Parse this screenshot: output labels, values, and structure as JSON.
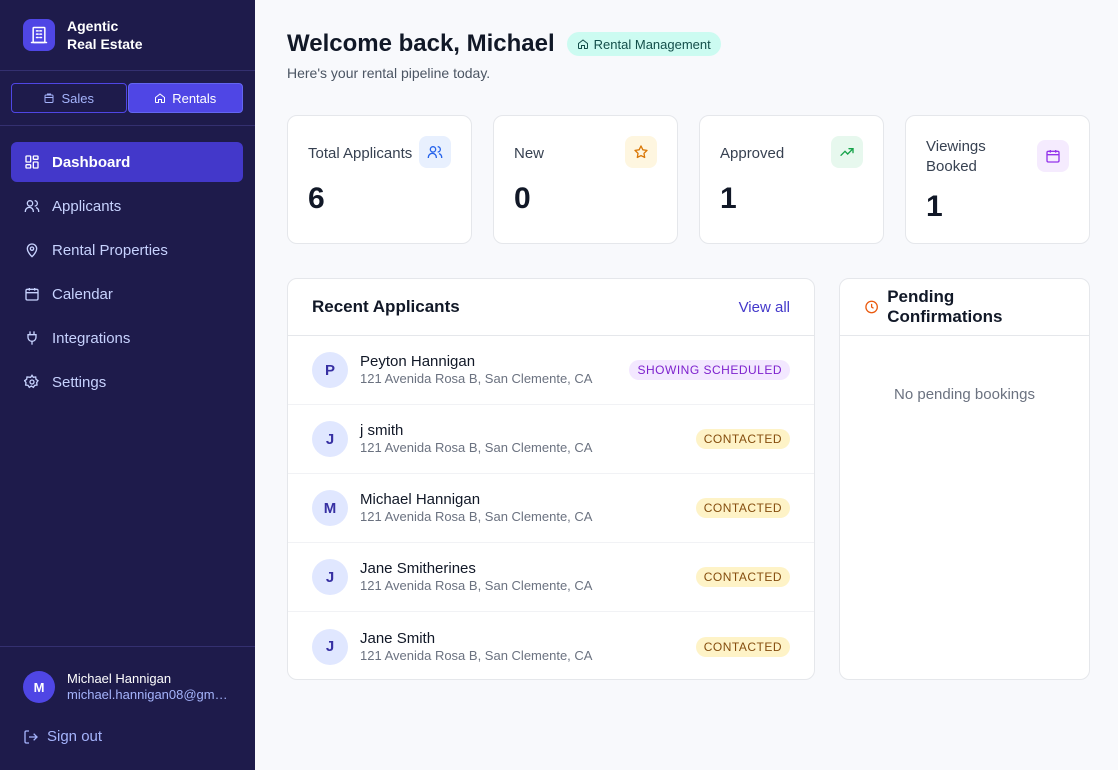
{
  "brand": {
    "line1": "Agentic",
    "line2": "Real Estate",
    "logo_icon": "building-icon",
    "color": "#4f46e5"
  },
  "mode_switch": {
    "sales": "Sales",
    "rentals": "Rentals",
    "active": "rentals"
  },
  "nav": [
    {
      "label": "Dashboard",
      "icon": "grid-icon",
      "active": true
    },
    {
      "label": "Applicants",
      "icon": "users-icon"
    },
    {
      "label": "Rental Properties",
      "icon": "map-pin-icon"
    },
    {
      "label": "Calendar",
      "icon": "calendar-icon"
    },
    {
      "label": "Integrations",
      "icon": "plug-icon"
    },
    {
      "label": "Settings",
      "icon": "gear-icon"
    }
  ],
  "user": {
    "initial": "M",
    "name": "Michael Hannigan",
    "email": "michael.hannigan08@gmail.com"
  },
  "signout": "Sign out",
  "header": {
    "title": "Welcome back, Michael",
    "pill": "Rental Management",
    "subtitle": "Here's your rental pipeline today."
  },
  "stats": [
    {
      "label": "Total Applicants",
      "value": "6",
      "icon": "users-icon",
      "icon_color": "#2563eb",
      "icon_bg": "#e8f0fe"
    },
    {
      "label": "New",
      "value": "0",
      "icon": "star-icon",
      "icon_color": "#d97706",
      "icon_bg": "#fef6e0"
    },
    {
      "label": "Approved",
      "value": "1",
      "icon": "trending-up-icon",
      "icon_color": "#16a34a",
      "icon_bg": "#e7f8ee"
    },
    {
      "label": "Viewings Booked",
      "value": "1",
      "icon": "calendar-icon",
      "icon_color": "#9333ea",
      "icon_bg": "#f5ebfe"
    }
  ],
  "recent": {
    "title": "Recent Applicants",
    "view_all": "View all",
    "rows": [
      {
        "initial": "P",
        "name": "Peyton Hannigan",
        "address": "121 Avenida Rosa B, San Clemente, CA",
        "status": "SHOWING SCHEDULED",
        "status_color": "#7e22ce",
        "status_bg": "#f3e8ff"
      },
      {
        "initial": "J",
        "name": "j smith",
        "address": "121 Avenida Rosa B, San Clemente, CA",
        "status": "CONTACTED",
        "status_color": "#854d0e",
        "status_bg": "#fef3c7"
      },
      {
        "initial": "M",
        "name": "Michael Hannigan",
        "address": "121 Avenida Rosa B, San Clemente, CA",
        "status": "CONTACTED",
        "status_color": "#854d0e",
        "status_bg": "#fef3c7"
      },
      {
        "initial": "J",
        "name": "Jane Smitherines",
        "address": "121 Avenida Rosa B, San Clemente, CA",
        "status": "CONTACTED",
        "status_color": "#854d0e",
        "status_bg": "#fef3c7"
      },
      {
        "initial": "J",
        "name": "Jane Smith",
        "address": "121 Avenida Rosa B, San Clemente, CA",
        "status": "CONTACTED",
        "status_color": "#854d0e",
        "status_bg": "#fef3c7"
      }
    ]
  },
  "pending": {
    "title": "Pending Confirmations",
    "icon": "clock-icon",
    "icon_color": "#ea580c",
    "empty": "No pending bookings"
  }
}
